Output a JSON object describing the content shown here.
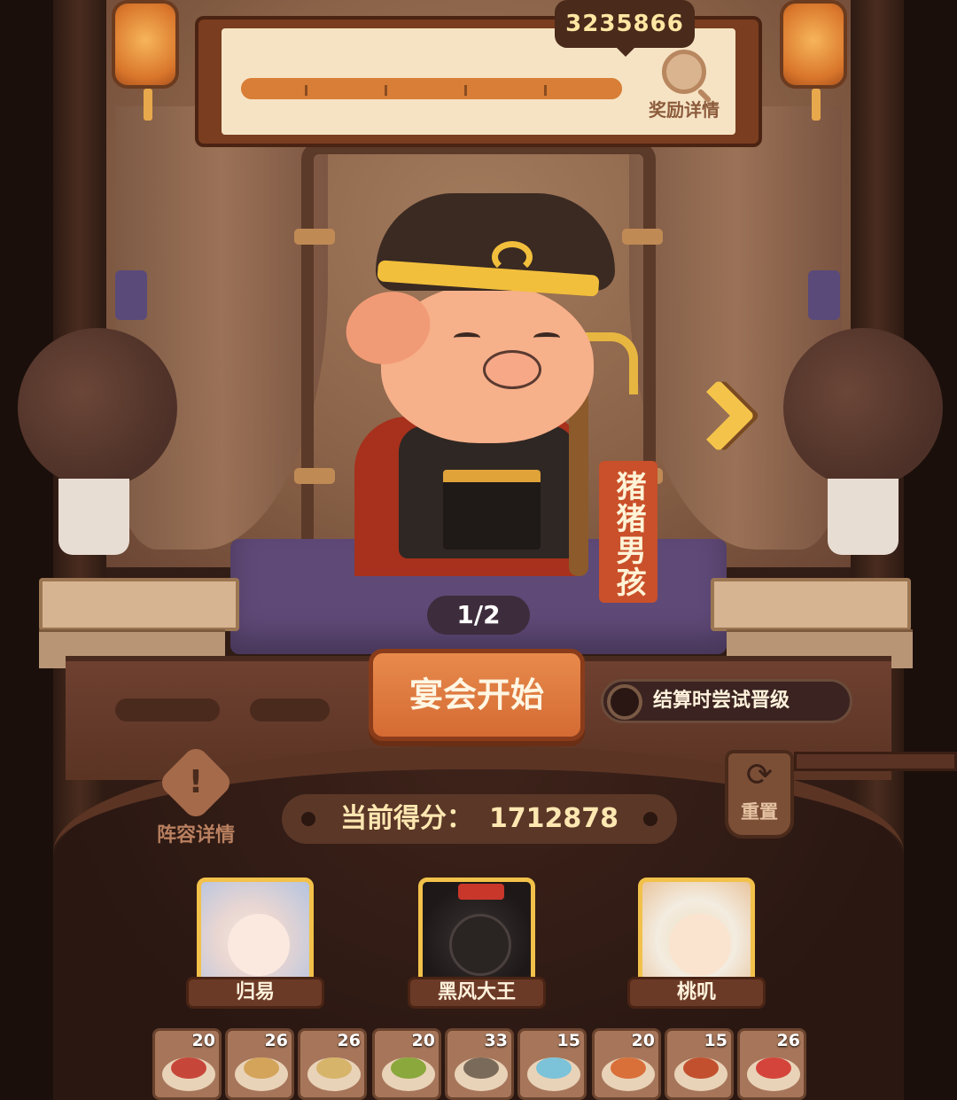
{
  "header": {
    "top_score": "3235866",
    "progress": 1.0,
    "reward_label": "奖励详情"
  },
  "character": {
    "name": "猪猪男孩",
    "page": "1/2"
  },
  "actions": {
    "start_label": "宴会开始",
    "promote_label": "结算时尝试晋级",
    "lineup_label": "阵容详情",
    "reset_label": "重置"
  },
  "score": {
    "label": "当前得分：",
    "value": "1712878"
  },
  "heroes": [
    {
      "name": "归易"
    },
    {
      "name": "黑风大王"
    },
    {
      "name": "桃叽"
    }
  ],
  "dishes": [
    {
      "count": "20",
      "color": "#c7463a"
    },
    {
      "count": "26",
      "color": "#d3a45a"
    },
    {
      "count": "26",
      "color": "#d6b46a"
    },
    {
      "count": "20",
      "color": "#8aa83c"
    },
    {
      "count": "33",
      "color": "#7a6a5a"
    },
    {
      "count": "15",
      "color": "#7cc3d9"
    },
    {
      "count": "20",
      "color": "#d9703a"
    },
    {
      "count": "15",
      "color": "#c2502f"
    },
    {
      "count": "26",
      "color": "#d4443a"
    }
  ]
}
